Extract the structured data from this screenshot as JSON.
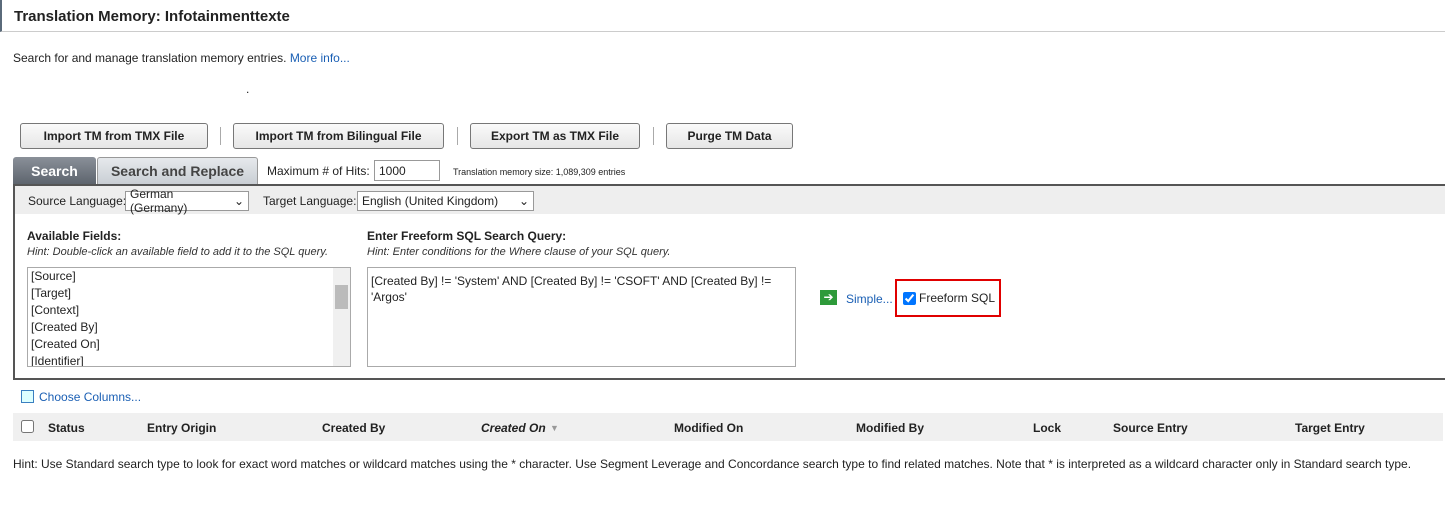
{
  "title": "Translation Memory: Infotainmenttexte",
  "intro": "Search for and manage translation memory entries.",
  "more_info": "More info...",
  "dot": ".",
  "toolbar": {
    "import_tmx": "Import TM from TMX File",
    "import_bilingual": "Import TM from Bilingual File",
    "export_tmx": "Export TM as TMX File",
    "purge": "Purge TM Data"
  },
  "tabs": {
    "search": "Search",
    "search_replace": "Search and Replace"
  },
  "max_hits_label": "Maximum # of Hits:",
  "max_hits": "1000",
  "tm_size": "Translation memory size: 1,089,309 entries",
  "source_lang_label": "Source Language:",
  "source_lang": "German (Germany)",
  "target_lang_label": "Target Language:",
  "target_lang": "English (United Kingdom)",
  "fields": {
    "label": "Available Fields:",
    "hint": "Hint: Double-click an available field to add it to the SQL query.",
    "items": [
      "[Source]",
      "[Target]",
      "[Context]",
      "[Created By]",
      "[Created On]",
      "[Identifier]"
    ]
  },
  "query": {
    "label": "Enter Freeform SQL Search Query:",
    "hint": "Hint: Enter conditions for the Where clause of your SQL query.",
    "value": "[Created By] != 'System' AND [Created By] != 'CSOFT' AND [Created By] != 'Argos'"
  },
  "simple": "Simple...",
  "freeform": "Freeform SQL",
  "choose_columns": "Choose Columns...",
  "columns": [
    "Status",
    "Entry Origin",
    "Created By",
    "Created On",
    "Modified On",
    "Modified By",
    "Lock",
    "Source Entry",
    "Target Entry"
  ],
  "footer_hint": "Hint: Use Standard search type to look for exact word matches or wildcard matches using the * character. Use Segment Leverage and Concordance search type to find related matches. Note that * is interpreted as a wildcard character only in Standard search type."
}
